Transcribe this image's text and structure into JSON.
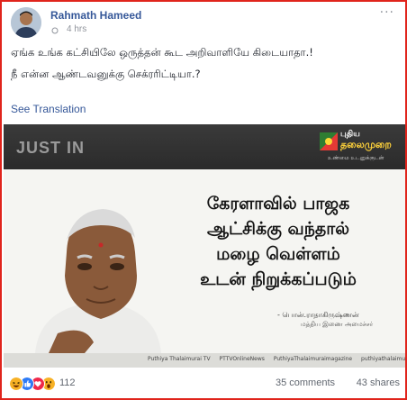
{
  "post": {
    "author": "Rahmath Hameed",
    "time": "4 hrs",
    "menu_glyph": "···",
    "text_line1": "ஏங்க உங்க கட்சியிலே ஒருத்தன் கூட அறிவாளியே கிடையாதா.!",
    "text_line2": "நீ என்ன ஆண்டவனுக்கு செக்ரரிட்டியா.?",
    "see_translation": "See Translation"
  },
  "media": {
    "just_in": "JUST IN",
    "logo_line1": "புதிய",
    "logo_line2": "தலைமுறை",
    "logo_line3": "உண்மை உடனுக்குடன்",
    "quote_lines": [
      "கேரளாவில் பாஜக",
      "ஆட்சிக்கு வந்தால்",
      "மழை வெள்ளம்",
      "உடன் நிறுக்கப்படும்"
    ],
    "byline": "- பொன்.ராதாகிருஷ்ணன்",
    "byline_sub": "மத்திய இணை அமைச்சர்",
    "socials": [
      "Puthiya Thalaimurai TV",
      "PTTVOnlineNews",
      "PuthiyaThalaimuraimagazine",
      "puthiyathalaimu"
    ]
  },
  "footer": {
    "reaction_count": "112",
    "comments": "35 comments",
    "shares": "43 shares",
    "reactions": [
      "haha",
      "like",
      "love",
      "wow"
    ]
  },
  "colors": {
    "border": "#e0241c",
    "link": "#365899",
    "muted": "#90949c"
  }
}
